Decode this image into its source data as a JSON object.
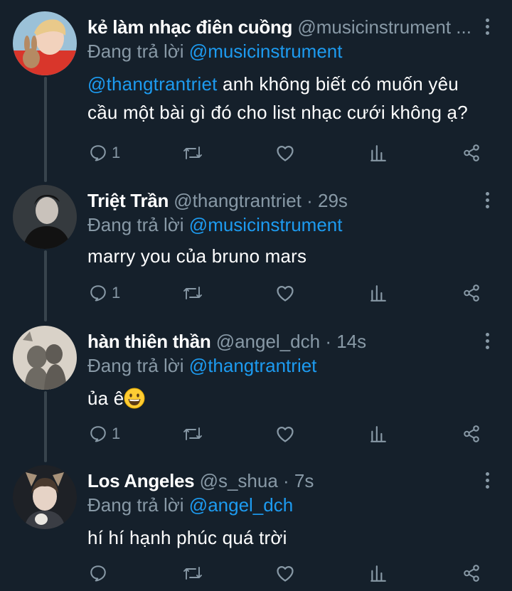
{
  "tweets": [
    {
      "display_name": "kẻ làm nhạc điên cuồng",
      "handle_meta": "@musicinstrument ...",
      "reply_prefix": "Đang trả lời",
      "reply_to": "@musicinstrument",
      "body_mention": "@thangtrantriet",
      "body_line1": " anh không biết có muốn yêu",
      "body_line2": "cầu một bài gì đó cho list nhạc cưới không ạ?",
      "reply_count": "1"
    },
    {
      "display_name": "Triệt Trần",
      "handle_meta": "@thangtrantriet · 29s",
      "reply_prefix": "Đang trả lời",
      "reply_to": "@musicinstrument",
      "body": "marry you của bruno mars",
      "reply_count": "1"
    },
    {
      "display_name": "hàn thiên thần",
      "handle_meta": "@angel_dch · 14s",
      "reply_prefix": "Đang trả lời",
      "reply_to": "@thangtrantriet",
      "body": "ủa ê",
      "reply_count": "1"
    },
    {
      "display_name": "Los Angeles",
      "handle_meta": "@s_shua · 7s",
      "reply_prefix": "Đang trả lời",
      "reply_to": "@angel_dch",
      "body": "hí hí hạnh phúc quá trời",
      "reply_count": ""
    }
  ],
  "icons": {
    "reply": "reply-icon",
    "retweet": "retweet-icon",
    "like": "heart-icon",
    "analytics": "analytics-icon",
    "share": "share-icon",
    "more": "more-vertical-icon",
    "emoji": "grinning-face-emoji"
  },
  "colors": {
    "background": "#15202b",
    "mention": "#1d9bf0",
    "secondary_text": "#8899a6",
    "thread_line": "#38444d"
  }
}
